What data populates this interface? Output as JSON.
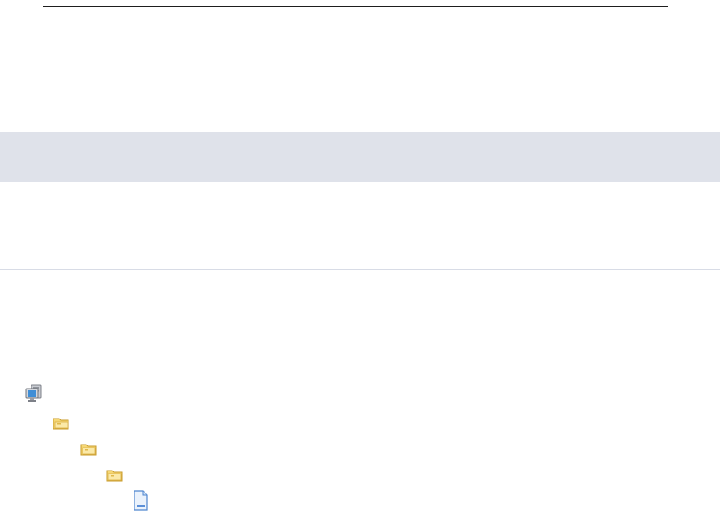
{
  "header": {
    "title": ""
  },
  "table": {
    "columns": [
      "",
      ""
    ]
  },
  "tree": {
    "nodes": [
      {
        "icon": "computer-icon",
        "label": ""
      },
      {
        "icon": "folder-icon",
        "label": ""
      },
      {
        "icon": "folder-icon",
        "label": ""
      },
      {
        "icon": "folder-icon",
        "label": ""
      },
      {
        "icon": "document-icon",
        "label": ""
      }
    ]
  },
  "colors": {
    "band": "#dfe2ea",
    "separator": "#d8dce6",
    "folder": "#f4d36b",
    "document": "#5b8fd8"
  }
}
